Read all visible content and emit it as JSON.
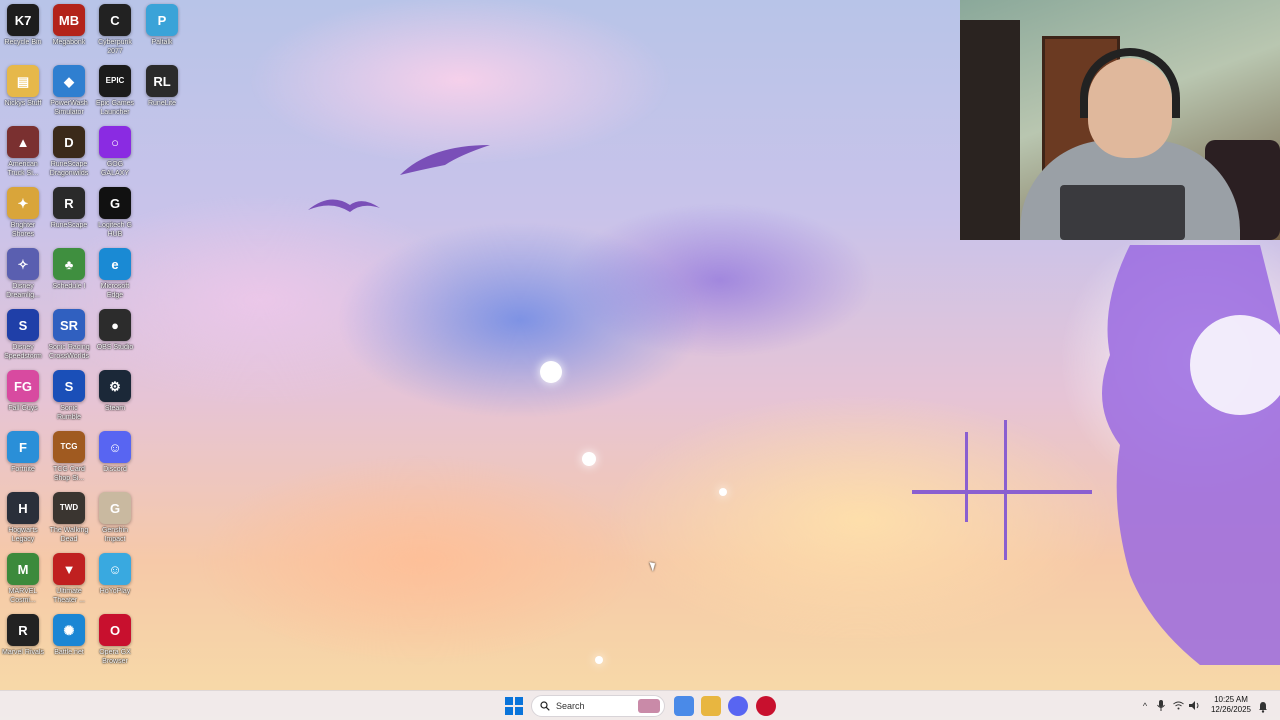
{
  "desktop": {
    "icons": [
      {
        "label": "Recycle Bin",
        "glyph": "K7",
        "color": "#1d1d1d",
        "col": 0,
        "row": 0
      },
      {
        "label": "Megabonk",
        "glyph": "MB",
        "color": "#b3231a",
        "col": 1,
        "row": 0
      },
      {
        "label": "Cyberpunk\n2077",
        "glyph": "C",
        "color": "#222222",
        "col": 2,
        "row": 0
      },
      {
        "label": "Paltalk",
        "glyph": "P",
        "color": "#3aa3d8",
        "col": 3,
        "row": 0
      },
      {
        "label": "Nickys Stuff",
        "glyph": "▤",
        "color": "#e6b84a",
        "col": 0,
        "row": 1
      },
      {
        "label": "PowerWash\nSimulator",
        "glyph": "◆",
        "color": "#2f7fd0",
        "col": 1,
        "row": 1
      },
      {
        "label": "Epic Games\nLauncher",
        "glyph": "EPIC",
        "color": "#1b1b1b",
        "col": 2,
        "row": 1
      },
      {
        "label": "RuneLite",
        "glyph": "RL",
        "color": "#2b2b2b",
        "col": 3,
        "row": 1
      },
      {
        "label": "American\nTruck Si...",
        "glyph": "▲",
        "color": "#7a3030",
        "col": 0,
        "row": 2
      },
      {
        "label": "RuneScape\nDragonwilds",
        "glyph": "D",
        "color": "#3b2a1a",
        "col": 1,
        "row": 2
      },
      {
        "label": "GOG GALAXY",
        "glyph": "○",
        "color": "#8a2be2",
        "col": 2,
        "row": 2
      },
      {
        "label": "Brighter\nShores",
        "glyph": "✦",
        "color": "#d9a53a",
        "col": 0,
        "row": 3
      },
      {
        "label": "RuneScape",
        "glyph": "R",
        "color": "#2a2a2a",
        "col": 1,
        "row": 3
      },
      {
        "label": "Logitech G\nHUB",
        "glyph": "G",
        "color": "#111111",
        "col": 2,
        "row": 3
      },
      {
        "label": "Disney\nDreamlig...",
        "glyph": "✧",
        "color": "#5a5fb0",
        "col": 0,
        "row": 4
      },
      {
        "label": "Schedule I",
        "glyph": "♣",
        "color": "#3f8f3f",
        "col": 1,
        "row": 4
      },
      {
        "label": "Microsoft\nEdge",
        "glyph": "e",
        "color": "#1a8ad4",
        "col": 2,
        "row": 4
      },
      {
        "label": "Disney\nSpeedstorm",
        "glyph": "S",
        "color": "#1f3fa8",
        "col": 0,
        "row": 5
      },
      {
        "label": "Sonic Racing\nCrossWorlds",
        "glyph": "SR",
        "color": "#3060c0",
        "col": 1,
        "row": 5
      },
      {
        "label": "OBS Studio",
        "glyph": "●",
        "color": "#2c2c2c",
        "col": 2,
        "row": 5
      },
      {
        "label": "Fall Guys",
        "glyph": "FG",
        "color": "#d84aa0",
        "col": 0,
        "row": 6
      },
      {
        "label": "Sonic\nRumble",
        "glyph": "S",
        "color": "#1a4fb8",
        "col": 1,
        "row": 6
      },
      {
        "label": "Steam",
        "glyph": "⚙",
        "color": "#1b2838",
        "col": 2,
        "row": 6
      },
      {
        "label": "Fortnite",
        "glyph": "F",
        "color": "#2a8fd8",
        "col": 0,
        "row": 7
      },
      {
        "label": "TCG Card\nShop Si...",
        "glyph": "TCG",
        "color": "#a05a20",
        "col": 1,
        "row": 7
      },
      {
        "label": "Discord",
        "glyph": "☺",
        "color": "#5865f2",
        "col": 2,
        "row": 7
      },
      {
        "label": "Hogwarts\nLegacy",
        "glyph": "H",
        "color": "#2a2f3a",
        "col": 0,
        "row": 8
      },
      {
        "label": "The Walking\nDead",
        "glyph": "TWD",
        "color": "#3a3530",
        "col": 1,
        "row": 8
      },
      {
        "label": "Genshin\nImpact",
        "glyph": "G",
        "color": "#c9b9a0",
        "col": 2,
        "row": 8
      },
      {
        "label": "MARVEL\nCosmi...",
        "glyph": "M",
        "color": "#3c8a3c",
        "col": 0,
        "row": 9
      },
      {
        "label": "Ultimate\nTheater ...",
        "glyph": "▼",
        "color": "#c02020",
        "col": 1,
        "row": 9
      },
      {
        "label": "HoYoPlay",
        "glyph": "☺",
        "color": "#39a9e0",
        "col": 2,
        "row": 9
      },
      {
        "label": "Marvel Rivals",
        "glyph": "R",
        "color": "#222222",
        "col": 0,
        "row": 10
      },
      {
        "label": "Battle.net",
        "glyph": "✺",
        "color": "#1b86d4",
        "col": 1,
        "row": 10
      },
      {
        "label": "Opera GX\nBrowser",
        "glyph": "O",
        "color": "#c8102e",
        "col": 2,
        "row": 10
      }
    ]
  },
  "taskbar": {
    "search_placeholder": "Search",
    "pinned": [
      {
        "name": "widgets",
        "color": "#c98aa8"
      },
      {
        "name": "copilot",
        "color": "#4a8ae8"
      },
      {
        "name": "file-explorer",
        "color": "#e8b640"
      },
      {
        "name": "discord",
        "color": "#5865f2"
      },
      {
        "name": "opera-gx",
        "color": "#c8102e"
      }
    ],
    "tray": {
      "chevron": "^",
      "mic": "🎤",
      "wifi": "◜",
      "volume": "🔊"
    },
    "clock": {
      "time": "10:25 AM",
      "date": "12/26/2025"
    }
  }
}
